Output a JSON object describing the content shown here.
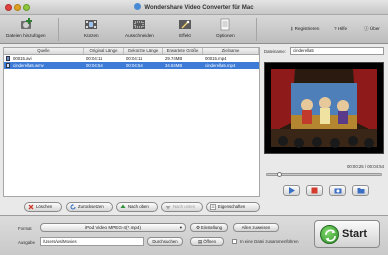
{
  "window": {
    "title": "Wondershare Video Converter für Mac"
  },
  "toolbar": {
    "add_files": "Dateien hinzufügen",
    "trim": "Kürzen",
    "crop": "Ausschneiden",
    "effect": "Effekt",
    "options": "Optionen",
    "register": "Registrieren",
    "help": "Hilfe",
    "about": "Über"
  },
  "filelist": {
    "columns": [
      "Quelle",
      "Original Länge",
      "Gekürzte Länge",
      "Erwartete Größe",
      "Zielname"
    ],
    "rows": [
      {
        "source": "00015.avi",
        "original_length": "00:04:11",
        "trimmed_length": "00:04:11",
        "expected_size": "29.74MB",
        "target_name": "00015.mp4",
        "selected": false
      },
      {
        "source": "cinderella5.wmv",
        "original_length": "00:04:54",
        "trimmed_length": "00:04:54",
        "expected_size": "34.84MB",
        "target_name": "cinderella5.mp4",
        "selected": true
      }
    ]
  },
  "preview": {
    "dest_label": "Dateiname:",
    "dest_value": "cinderella5",
    "time": "00:00:25 / 00:04:54",
    "progress": 0.09
  },
  "file_buttons": {
    "delete": "Löschen",
    "reset": "Zurücksetzen",
    "move_up": "Nach oben",
    "move_down": "Nach unten",
    "properties": "Eigenschaften"
  },
  "bottom": {
    "format_label": "Format",
    "format_value": "iPod Video MPEG-4(*.mp4)",
    "settings": "Einstellung",
    "apply_all": "Allen zuweisen",
    "output_label": "Ausgabe",
    "output_path": "/Users/ws/Movies",
    "browse": "Durchsuchen",
    "open": "Öffnen",
    "merge_label": "In eine Datei zusammenführen",
    "merge_checked": false,
    "start": "Start"
  }
}
